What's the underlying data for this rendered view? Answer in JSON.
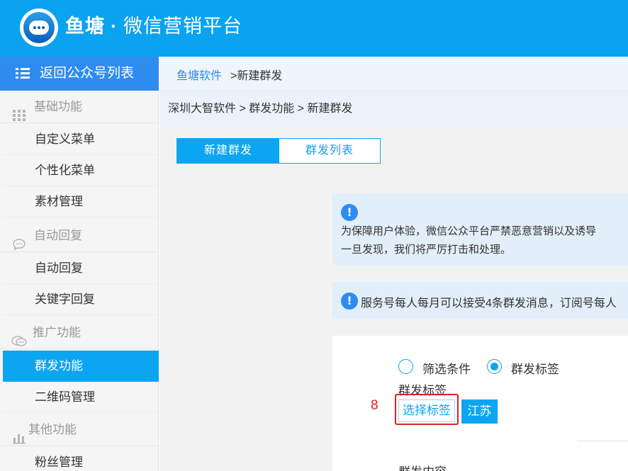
{
  "header": {
    "brand_name": "鱼塘",
    "brand_separator": "·",
    "brand_subtitle": "微信营销平台"
  },
  "sidebar": {
    "back_label": "返回公众号列表",
    "groups": [
      {
        "label": "基础功能",
        "icon": "grid-icon",
        "items": [
          "自定义菜单",
          "个性化菜单",
          "素材管理"
        ]
      },
      {
        "label": "自动回复",
        "icon": "chat-bubble-icon",
        "items": [
          "自动回复",
          "关键字回复"
        ]
      },
      {
        "label": "推广功能",
        "icon": "speech-bubbles-icon",
        "items": [
          "群发功能",
          "二维码管理"
        ]
      },
      {
        "label": "其他功能",
        "icon": "bar-chart-icon",
        "items": [
          "粉丝管理"
        ]
      }
    ],
    "active_item": "群发功能"
  },
  "breadcrumb_top": {
    "link": "鱼塘软件",
    "current": ">新建群发"
  },
  "breadcrumb_path": "深圳大智软件 > 群发功能 > 新建群发",
  "tabs": [
    "新建群发",
    "群发列表"
  ],
  "notice1": {
    "line1": "为保障用户体验，微信公众平台严禁恶意营销以及诱导",
    "line2": "一旦发现，我们将严厉打击和处理。"
  },
  "notice2": {
    "text": "服务号每人每月可以接受4条群发消息，订阅号每人"
  },
  "form": {
    "radio_filter": "筛选条件",
    "radio_tag": "群发标签",
    "selected_radio": "群发标签",
    "tag_label": "群发标签",
    "select_tag_button": "选择标签",
    "selected_tag": "江苏",
    "content_label": "群发内容"
  },
  "annotation": "8",
  "colors": {
    "header_bg": "#0aa3f0",
    "accent": "#0ba5f2",
    "back_button": "#2e8cf0",
    "highlight": "#e02020"
  }
}
